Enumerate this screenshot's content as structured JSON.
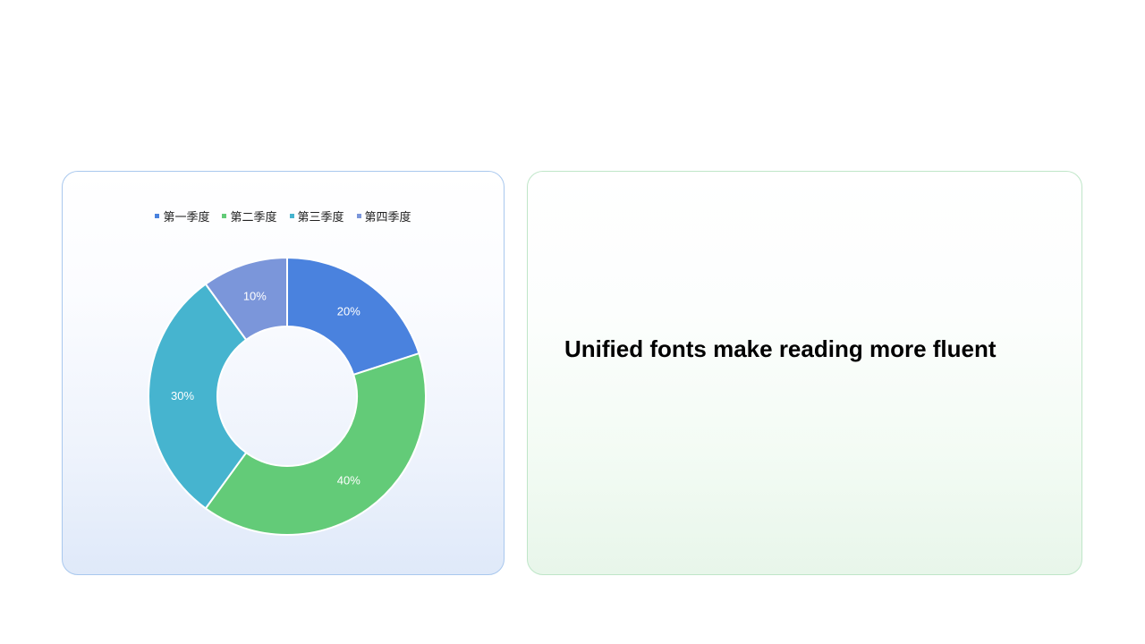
{
  "chart_data": {
    "type": "pie",
    "variant": "donut",
    "categories": [
      "第一季度",
      "第二季度",
      "第三季度",
      "第四季度"
    ],
    "values": [
      20,
      40,
      30,
      10
    ],
    "data_labels": [
      "20%",
      "40%",
      "30%",
      "10%"
    ],
    "colors": [
      "#4a82de",
      "#63cb78",
      "#46b4cf",
      "#7b96da"
    ],
    "legend_position": "top",
    "start_angle": "12 o'clock",
    "direction": "clockwise"
  },
  "text_panel": {
    "headline": "Unified fonts make reading more fluent"
  }
}
